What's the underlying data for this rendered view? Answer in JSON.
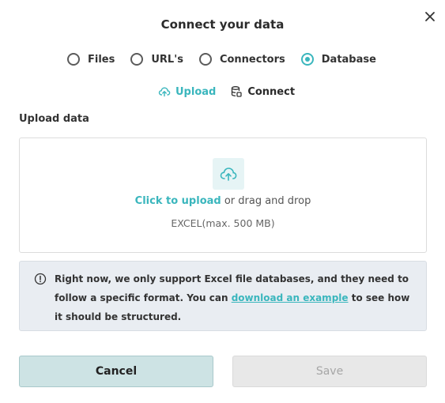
{
  "dialog": {
    "title": "Connect your data",
    "source_types": [
      {
        "label": "Files",
        "selected": false
      },
      {
        "label": "URL's",
        "selected": false
      },
      {
        "label": "Connectors",
        "selected": false
      },
      {
        "label": "Database",
        "selected": true
      }
    ],
    "subtabs": [
      {
        "label": "Upload",
        "active": true,
        "icon": "upload-cloud-icon"
      },
      {
        "label": "Connect",
        "active": false,
        "icon": "database-icon"
      }
    ],
    "section_label": "Upload data",
    "dropzone": {
      "link_text": "Click to upload",
      "rest_text": " or drag and drop",
      "hint": "EXCEL(max. 500 MB)",
      "icon": "cloud-upload-icon"
    },
    "info": {
      "icon": "info-icon",
      "text_before": "Right now, we only support Excel file databases, and they need to follow a specific format. You can ",
      "link_text": "download an example",
      "text_after": " to see how it should be structured."
    },
    "buttons": {
      "cancel": "Cancel",
      "save": "Save"
    }
  },
  "colors": {
    "accent": "#3ab6bd",
    "cancel_bg": "#cde3e4",
    "save_bg_disabled": "#e8e8e8",
    "info_bg": "#e9edf2"
  }
}
